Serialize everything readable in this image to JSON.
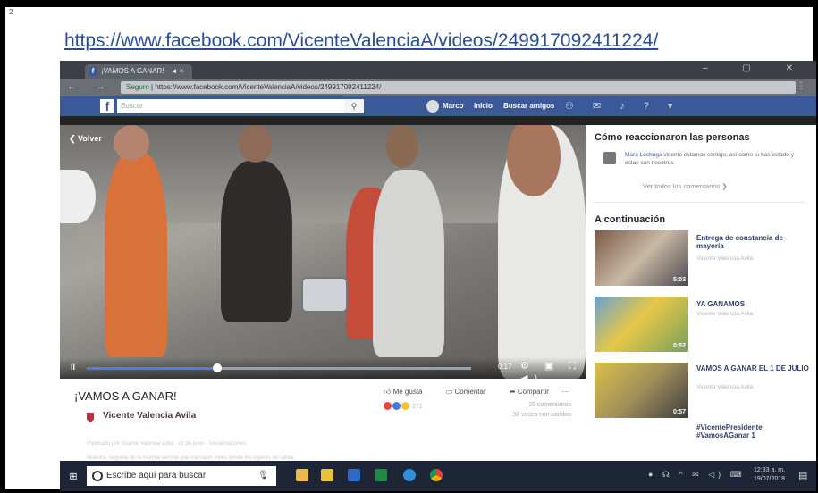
{
  "page": {
    "number": "2",
    "url": "https://www.facebook.com/VicenteValenciaA/videos/249917092411224/"
  },
  "browser": {
    "tab_title": "¡VAMOS A GANAR! · ◄ ×",
    "address_secure": "Seguro",
    "address_url": "https://www.facebook.com/VicenteValenciaA/videos/249917092411224/"
  },
  "facebook": {
    "search_placeholder": "Buscar",
    "user_name": "Marco",
    "home_label": "Inicio",
    "find_friends_label": "Buscar amigos"
  },
  "video": {
    "back_label": "Volver",
    "time": "0:17",
    "progress": 0.34,
    "title": "¡VAMOS A GANAR!",
    "page_name": "Vicente Valencia Avila",
    "like_label": "Me gusta",
    "comment_label": "Comentar",
    "share_label": "Compartir",
    "reactions_count": "271",
    "comments_count": "25 comentarios",
    "views": "32 veces con cambio",
    "faint_line_1": "Publicado por Vicente Valencia Avila · 21 de junio · Visualizaciones:",
    "faint_line_2": "Muestra, seguida de la marcha vecinal que marcaron miles desde los lugares de salida"
  },
  "sidebar": {
    "reactions_heading": "Cómo reaccionaron las personas",
    "comment_author": "Mara Lechuga",
    "comment_text": " vicente estamos contigo, así como tu has estado y estas con nosotros",
    "see_all": "Ver todos los comentarios",
    "next_heading": "A continuación",
    "up_next": [
      {
        "title": "Entrega de constancia de mayoría",
        "sub": "Vicente Valencia Avila",
        "duration": "5:03"
      },
      {
        "title": "YA GANAMOS",
        "sub": "Vicente Valencia Avila",
        "duration": "0:52"
      },
      {
        "title": "VAMOS A GANAR EL 1 DE JULIO",
        "sub": "Vicente Valencia Avila",
        "duration": "0:57"
      }
    ],
    "partial_title": "#VicentePresidente #VamosAGanar 1"
  },
  "taskbar": {
    "search_placeholder": "Escribe aquí para buscar",
    "time": "12:33 a. m.",
    "date": "19/07/2018"
  }
}
